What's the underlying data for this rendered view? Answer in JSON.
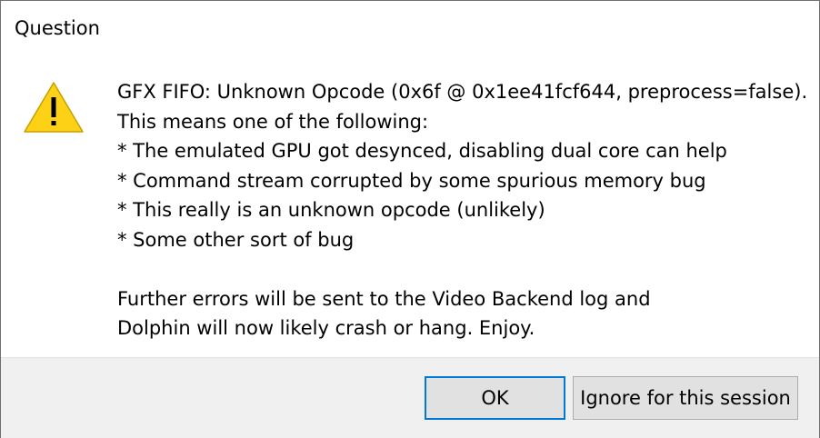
{
  "dialog": {
    "title": "Question",
    "icon": "warning-icon",
    "message_lines": [
      "GFX FIFO: Unknown Opcode (0x6f @ 0x1ee41fcf644, preprocess=false).",
      "This means one of the following:",
      "* The emulated GPU got desynced, disabling dual core can help",
      "* Command stream corrupted by some spurious memory bug",
      "* This really is an unknown opcode (unlikely)",
      "* Some other sort of bug",
      "",
      "Further errors will be sent to the Video Backend log and",
      "Dolphin will now likely crash or hang. Enjoy."
    ]
  },
  "buttons": {
    "ok_label": "OK",
    "ignore_label": "Ignore for this session"
  },
  "colors": {
    "warning_fill": "#fcd116",
    "focus_border": "#0078d7",
    "footer_bg": "#f0f0f0"
  }
}
